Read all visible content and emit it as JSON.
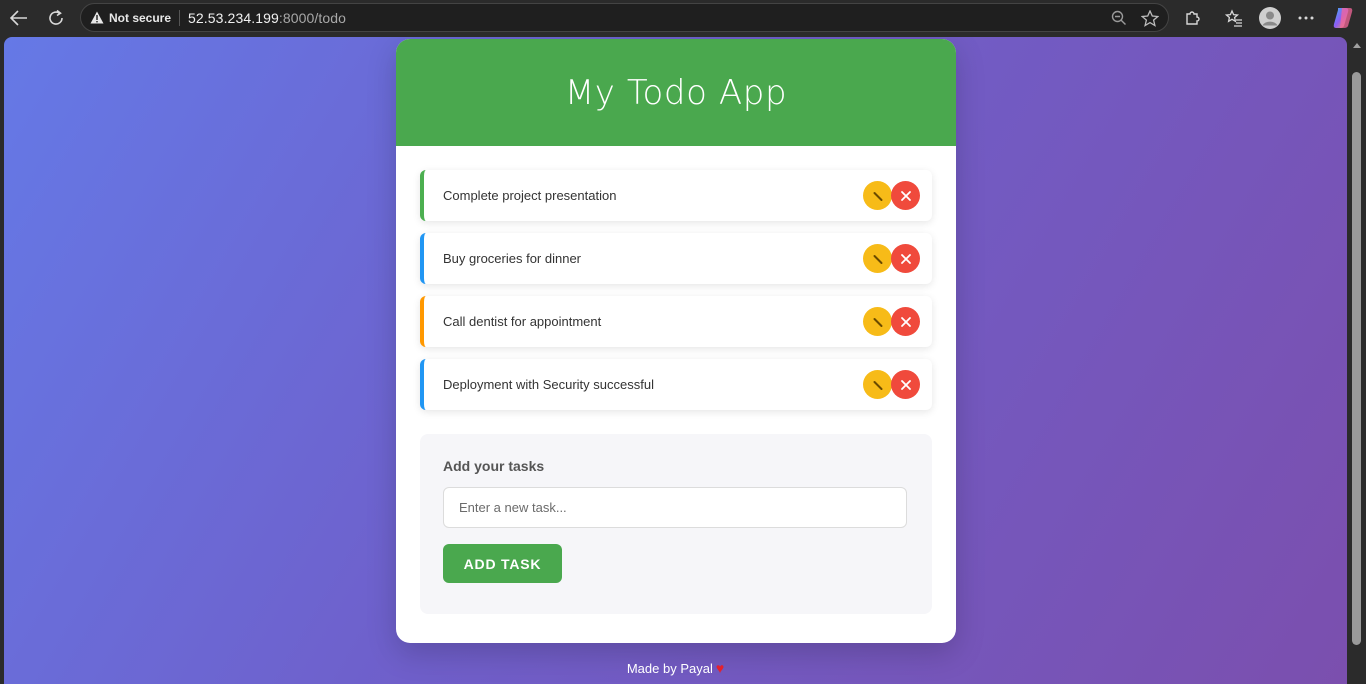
{
  "browser": {
    "security_label": "Not secure",
    "url_host": "52.53.234.199",
    "url_rest": ":8000/todo"
  },
  "app": {
    "title": "My Todo App",
    "tasks": [
      {
        "text": "Complete project presentation",
        "accent": "#4caf50"
      },
      {
        "text": "Buy groceries for dinner",
        "accent": "#2196f3"
      },
      {
        "text": "Call dentist for appointment",
        "accent": "#ff9800"
      },
      {
        "text": "Deployment with Security successful",
        "accent": "#2196f3"
      }
    ],
    "add_section": {
      "label": "Add your tasks",
      "placeholder": "Enter a new task...",
      "value": "",
      "button_label": "ADD TASK"
    },
    "footer_text": "Made by Payal",
    "footer_heart": "♥"
  },
  "colors": {
    "header_green": "#4aa84e",
    "edit_yellow": "#f7bb18",
    "delete_red": "#f04a3c",
    "background_gradient_start": "#6579e6",
    "background_gradient_end": "#7b4fae"
  }
}
